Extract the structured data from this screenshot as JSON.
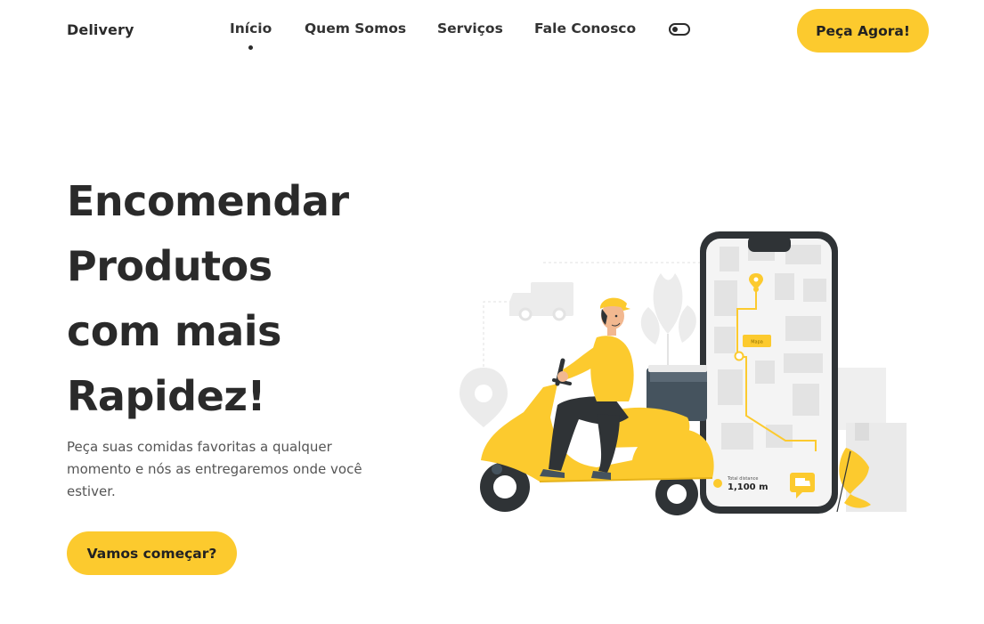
{
  "brand": {
    "name": "Delivery"
  },
  "nav": {
    "items": [
      {
        "label": "Início",
        "active": true
      },
      {
        "label": "Quem Somos",
        "active": false
      },
      {
        "label": "Serviços",
        "active": false
      },
      {
        "label": "Fale Conosco",
        "active": false
      }
    ],
    "theme_toggle_icon": "toggle-icon",
    "cta_label": "Peça Agora!"
  },
  "hero": {
    "title_lines": [
      "Encomendar",
      "Produtos",
      "com mais",
      "Rapidez!"
    ],
    "description": "Peça suas comidas favoritas a qualquer momento e nós as entregaremos onde você estiver.",
    "cta_label": "Vamos começar?"
  },
  "illustration": {
    "map_label": "Mapa",
    "distance_caption": "Total distance",
    "distance_value": "1,100 m",
    "icons": [
      "delivery-scooter-illustration",
      "phone-map-illustration",
      "map-pin-icon",
      "truck-icon",
      "chat-truck-icon",
      "leaf-icon"
    ]
  },
  "colors": {
    "accent": "#FCCA2E",
    "text_dark": "#2a2a2a",
    "text_muted": "#555555",
    "background": "#ffffff"
  }
}
